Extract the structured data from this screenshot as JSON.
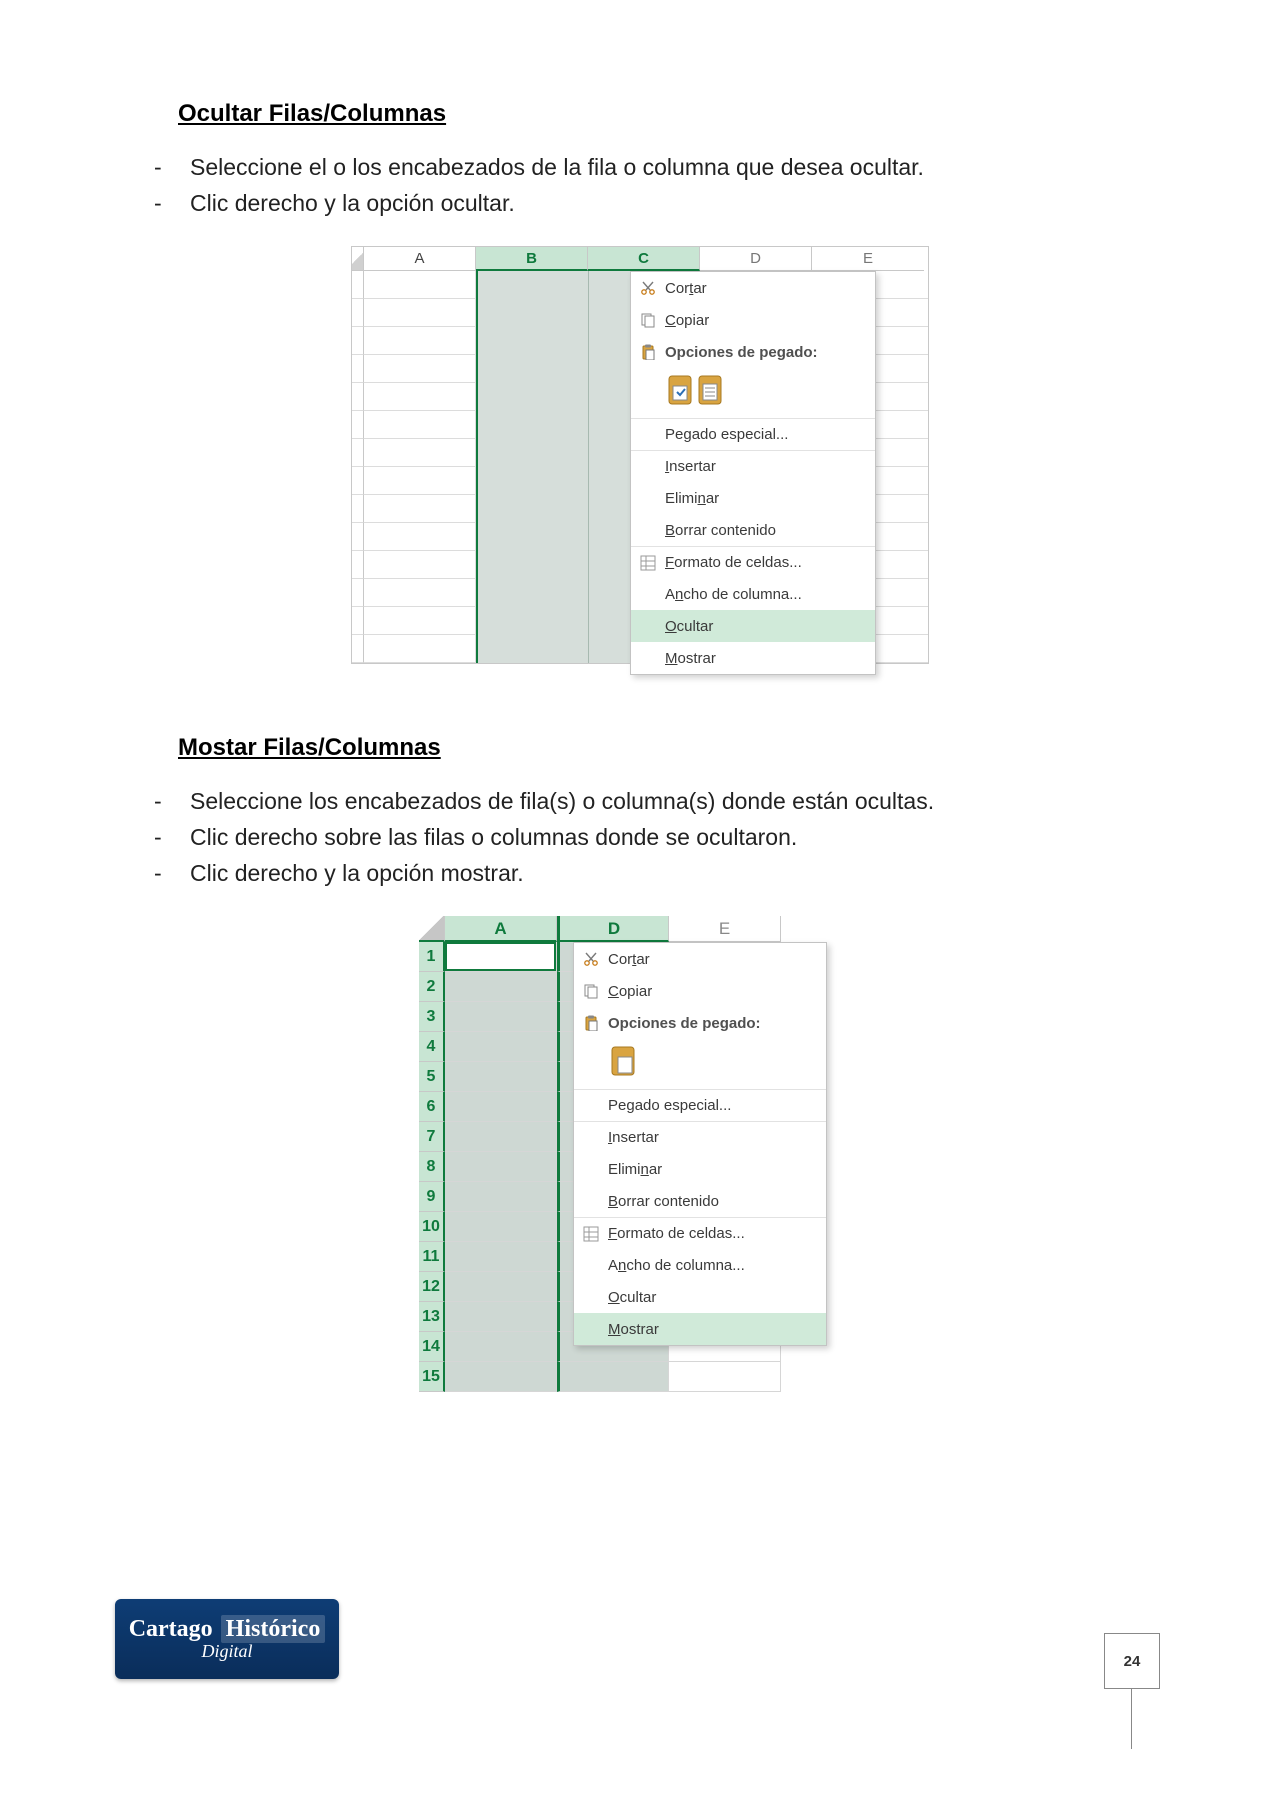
{
  "section1": {
    "title": "Ocultar Filas/Columnas",
    "steps": [
      "Seleccione el o los encabezados de la fila o columna que desea ocultar.",
      "Clic derecho y la opción ocultar."
    ],
    "columns": [
      "A",
      "B",
      "C",
      "D",
      "E"
    ],
    "selected_columns": [
      "B",
      "C"
    ],
    "context_menu": {
      "cut": "Cortar",
      "copy": "Copiar",
      "paste_options": "Opciones de pegado:",
      "paste_special": "Pegado especial...",
      "insert": "Insertar",
      "delete": "Eliminar",
      "clear": "Borrar contenido",
      "format": "Formato de celdas...",
      "width": "Ancho de columna...",
      "hide": "Ocultar",
      "show": "Mostrar",
      "highlighted": "hide"
    }
  },
  "section2": {
    "title": "Mostar Filas/Columnas",
    "steps": [
      "Seleccione los encabezados de fila(s) o columna(s) donde están ocultas.",
      "Clic derecho sobre las filas o columnas donde se ocultaron.",
      "Clic derecho y la opción mostrar."
    ],
    "columns": [
      "A",
      "D",
      "E"
    ],
    "rows": [
      "1",
      "2",
      "3",
      "4",
      "5",
      "6",
      "7",
      "8",
      "9",
      "10",
      "11",
      "12",
      "13",
      "14",
      "15"
    ],
    "context_menu": {
      "cut": "Cortar",
      "copy": "Copiar",
      "paste_options": "Opciones de pegado:",
      "paste_special": "Pegado especial...",
      "insert": "Insertar",
      "delete": "Eliminar",
      "clear": "Borrar contenido",
      "format": "Formato de celdas...",
      "width": "Ancho de columna...",
      "hide": "Ocultar",
      "show": "Mostrar",
      "highlighted": "show"
    }
  },
  "footer": {
    "line1a": "Cartago",
    "line1b": "Histórico",
    "line2": "Digital"
  },
  "page_number": "24"
}
